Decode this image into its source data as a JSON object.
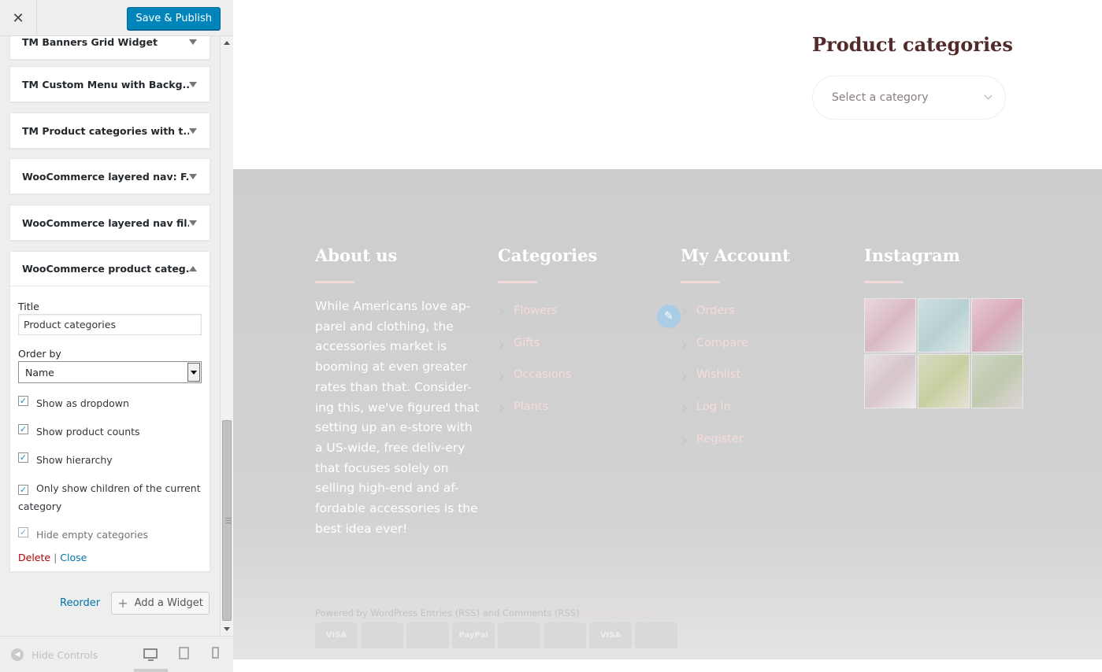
{
  "header": {
    "close_label": "✕",
    "save_label": "Save & Publish"
  },
  "widgets": [
    {
      "title": "TM Banners Grid Widget"
    },
    {
      "title": "TM Custom Menu with Backg..."
    },
    {
      "title": "TM Product categories with t..."
    },
    {
      "title": "WooCommerce layered nav: F..."
    },
    {
      "title": "WooCommerce layered nav fil..."
    },
    {
      "title": "WooCommerce product categ..."
    }
  ],
  "open_widget": {
    "title_label": "Title",
    "title_value": "Product categories",
    "orderby_label": "Order by",
    "orderby_value": "Name",
    "checkboxes": [
      {
        "label": "Show as dropdown",
        "checked": true
      },
      {
        "label": "Show product counts",
        "checked": true
      },
      {
        "label": "Show hierarchy",
        "checked": true
      },
      {
        "label": "Only show children of the current category",
        "checked": true
      },
      {
        "label": "Hide empty categories",
        "checked": true
      }
    ],
    "delete_label": "Delete",
    "separator": "|",
    "close_label": "Close"
  },
  "actions": {
    "reorder_label": "Reorder",
    "add_widget_label": "Add a Widget"
  },
  "footer_controls": {
    "hide_controls_label": "Hide Controls"
  },
  "preview": {
    "product_categories_title": "Product categories",
    "select_placeholder": "Select a category",
    "about": {
      "title": "About us",
      "text": "While Americans love ap-parel and clothing, the accessories market is booming at even greater rates than that. Consider-ing this, we've figured that setting up an e-store with a US-wide, free deliv-ery that focuses solely on selling high-end and af-fordable accessories is the best idea ever!"
    },
    "categories": {
      "title": "Categories",
      "items": [
        "Flowers",
        "Gifts",
        "Occasions",
        "Plants"
      ]
    },
    "account": {
      "title": "My Account",
      "items": [
        "Orders",
        "Compare",
        "Wishlist",
        "Log In",
        "Register"
      ]
    },
    "instagram": {
      "title": "Instagram"
    },
    "copyright": "Powered by WordPress Entries (RSS) and Comments (RSS)",
    "privacy": "Privacy Policy",
    "payments": [
      "VISA",
      "",
      "",
      "PayPal",
      "",
      "",
      "VISA",
      ""
    ]
  },
  "colors": {
    "accent": "#0085ba",
    "footer_bg": "#d0d0d0",
    "title_color": "#512a2a",
    "link_pink": "#f6dcdc"
  }
}
